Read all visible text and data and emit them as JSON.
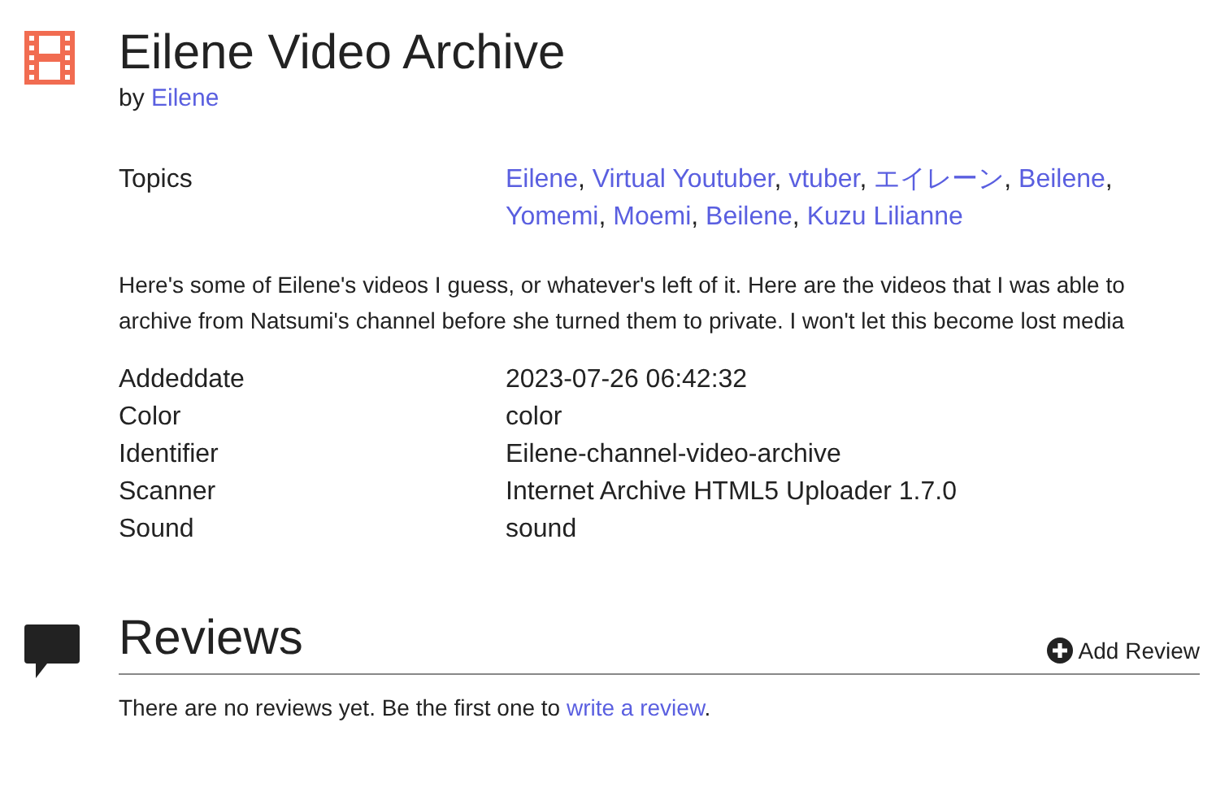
{
  "title": "Eilene Video Archive",
  "byline": {
    "prefix": "by",
    "author": "Eilene"
  },
  "topics": {
    "label": "Topics",
    "items": [
      "Eilene",
      "Virtual Youtuber",
      "vtuber",
      "エイレーン",
      "Beilene",
      "Yomemi",
      "Moemi",
      "Beilene",
      "Kuzu Lilianne"
    ],
    "separator": ","
  },
  "description": "Here's some of Eilene's videos I guess, or whatever's left of it. Here are the videos that I was able to archive from Natsumi's channel before she turned them to private. I won't let this become lost media",
  "metadata": [
    {
      "label": "Addeddate",
      "value": "2023-07-26 06:42:32"
    },
    {
      "label": "Color",
      "value": "color"
    },
    {
      "label": "Identifier",
      "value": "Eilene-channel-video-archive"
    },
    {
      "label": "Scanner",
      "value": "Internet Archive HTML5 Uploader 1.7.0"
    },
    {
      "label": "Sound",
      "value": "sound"
    }
  ],
  "reviews": {
    "title": "Reviews",
    "add_button": "Add Review",
    "empty_text": "There are no reviews yet. Be the first one to ",
    "empty_link": "write a review",
    "empty_end": "."
  }
}
